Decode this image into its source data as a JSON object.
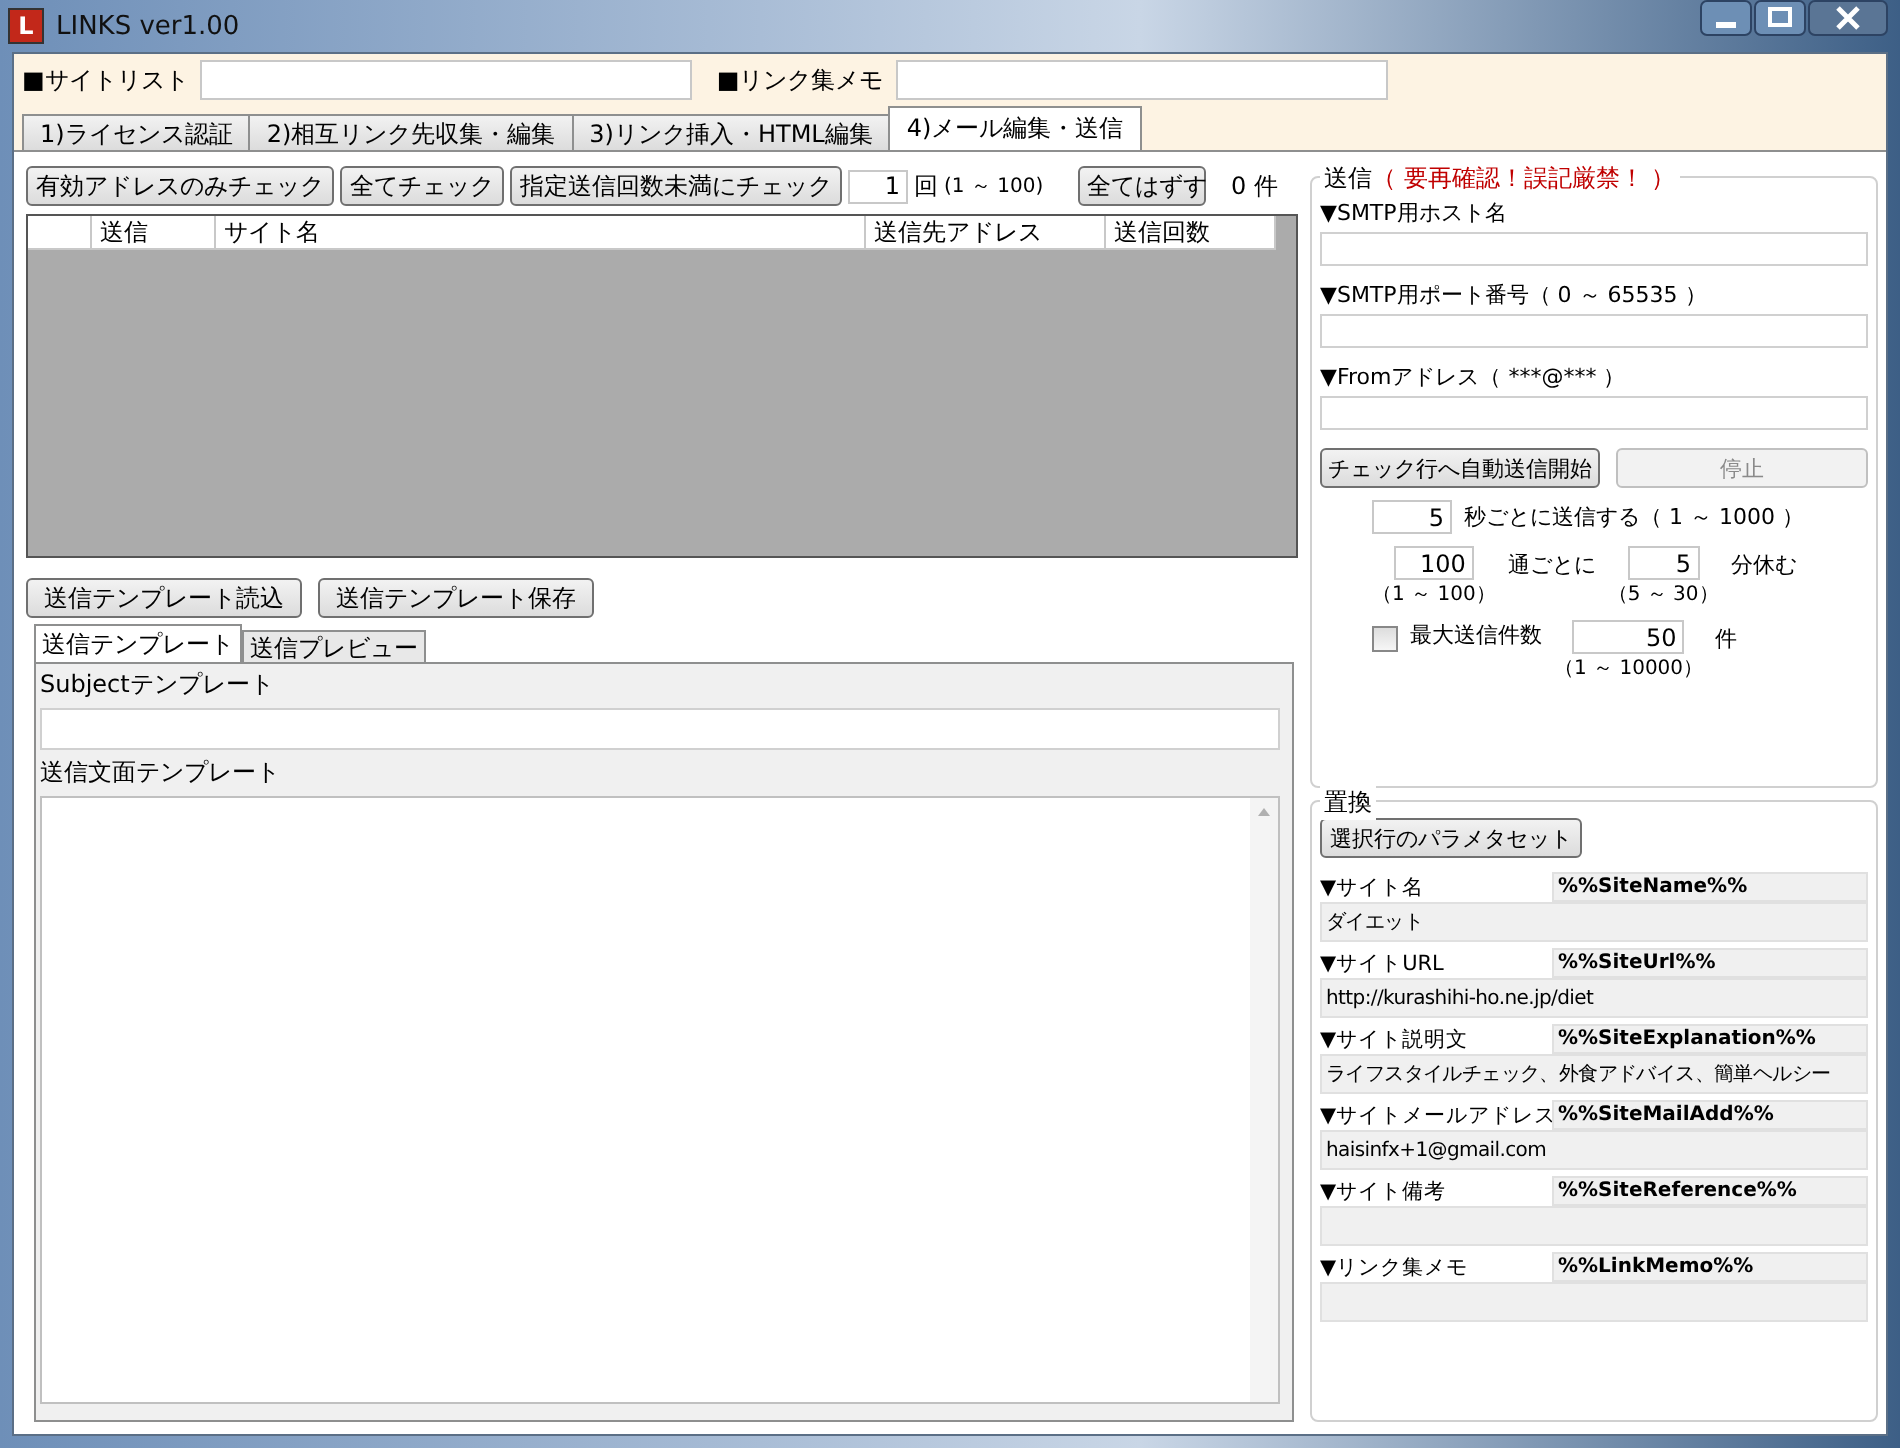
{
  "window": {
    "title": "LINKS ver1.00",
    "logo": "L"
  },
  "top_fields": [
    {
      "label": "■サイトリスト"
    },
    {
      "label": "■リンク集メモ"
    }
  ],
  "tabs": [
    {
      "label": "1)ライセンス認証",
      "selected": false
    },
    {
      "label": "2)相互リンク先収集・編集",
      "selected": false
    },
    {
      "label": "3)リンク挿入・HTML編集",
      "selected": false
    },
    {
      "label": "4)メール編集・送信",
      "selected": true
    }
  ],
  "toolbar": {
    "buttons": [
      "有効アドレスのみチェック",
      "全てチェック",
      "指定送信回数未満にチェック"
    ],
    "count_value": "1",
    "count_unit": "回",
    "count_range": "(1 ～ 100)",
    "clear_button": "全てはずす",
    "total": "0 件"
  },
  "table": {
    "columns": [
      "送信",
      "サイト名",
      "送信先アドレス",
      "送信回数"
    ]
  },
  "template_buttons": [
    "送信テンプレート読込",
    "送信テンプレート保存"
  ],
  "template_tabs": [
    {
      "label": "送信テンプレート",
      "selected": true
    },
    {
      "label": "送信プレビュー",
      "selected": false
    }
  ],
  "subject_label": "Subjectテンプレート",
  "body_label": "送信文面テンプレート",
  "send": {
    "legend": "送信",
    "warning": "（ 要再確認！誤記厳禁！ ）",
    "fields": [
      {
        "label": "▼SMTP用ホスト名"
      },
      {
        "label": "▼SMTP用ポート番号（ 0 ～ 65535 ）"
      },
      {
        "label": "▼Fromアドレス（ ***@*** ）"
      }
    ],
    "start_button": "チェック行へ自動送信開始",
    "stop_button": {
      "label": "停止",
      "disabled": true
    },
    "interval": {
      "value": "5",
      "text": "秒ごとに送信する（ 1 ～ 1000 ）"
    },
    "batch": {
      "value": "100",
      "unit": "通ごとに",
      "range": "（1 ～ 100）",
      "rest_value": "5",
      "rest_unit": "分休む",
      "rest_range": "（5 ～ 30）"
    },
    "max": {
      "checked": false,
      "label": "最大送信件数",
      "value": "50",
      "unit": "件",
      "range": "（1 ～ 10000）"
    }
  },
  "replace": {
    "legend": "置換",
    "button": "選択行のパラメタセット",
    "params": [
      {
        "label": "▼サイト名",
        "token": "%%SiteName%%",
        "value": "ダイエット"
      },
      {
        "label": "▼サイトURL",
        "token": "%%SiteUrl%%",
        "value": "http://kurashihi-ho.ne.jp/diet"
      },
      {
        "label": "▼サイト説明文",
        "token": "%%SiteExplanation%%",
        "value": "ライフスタイルチェック、外食アドバイス、簡単ヘルシー"
      },
      {
        "label": "▼サイトメールアドレス",
        "token": "%%SiteMailAdd%%",
        "value": "haisinfx+1@gmail.com"
      },
      {
        "label": "▼サイト備考",
        "token": "%%SiteReference%%"
      },
      {
        "label": "▼リンク集メモ",
        "token": "%%LinkMemo%%"
      }
    ]
  }
}
